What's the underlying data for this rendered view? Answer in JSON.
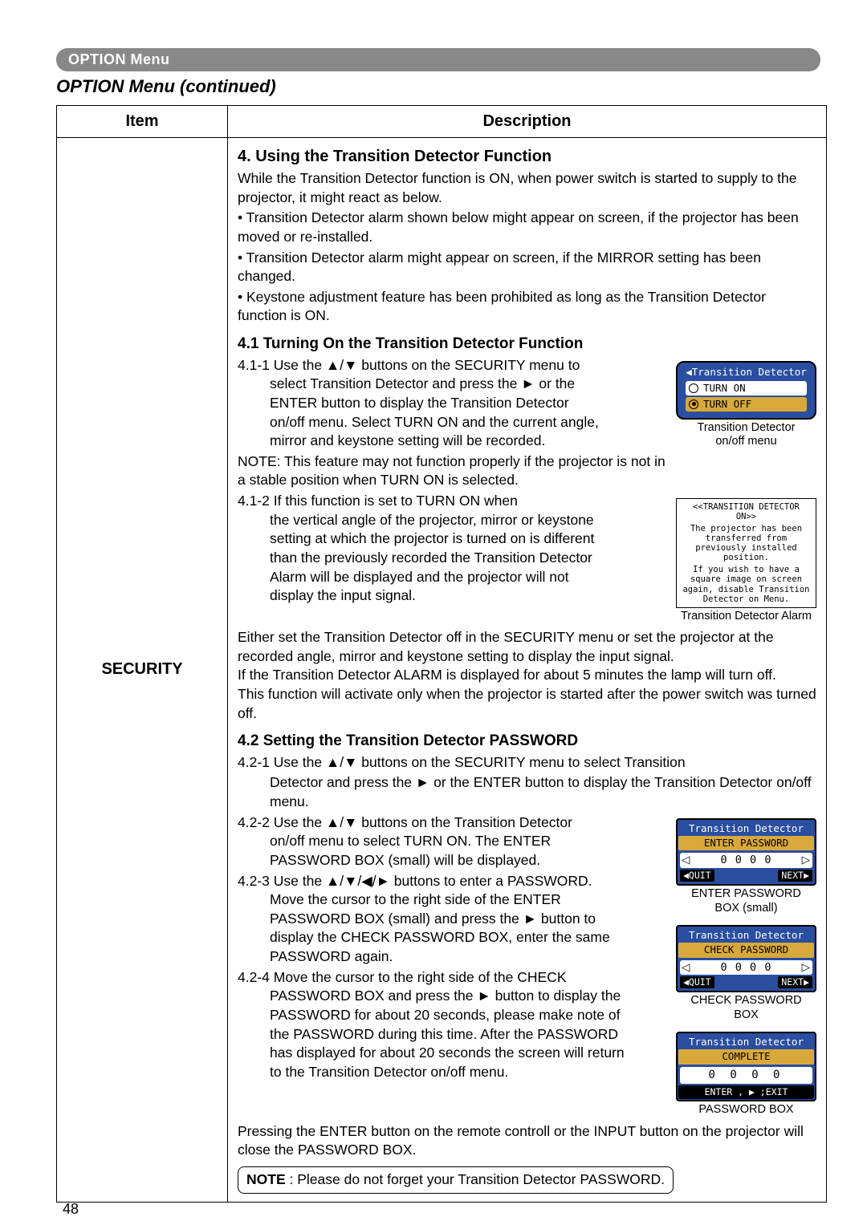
{
  "tab": {
    "label": "OPTION Menu"
  },
  "title": "OPTION Menu (continued)",
  "headers": {
    "item": "Item",
    "description": "Description"
  },
  "item_label": "SECURITY",
  "sec4": {
    "heading": "4. Using the Transition Detector Function",
    "p1": "While the Transition Detector function is ON, when power switch is started to supply to the projector, it might react as below.",
    "b1": "• Transition Detector alarm shown below might appear on screen, if the projector has been moved or re-installed.",
    "b2": "• Transition Detector alarm might appear on screen, if the MIRROR setting has been changed.",
    "b3": "• Keystone adjustment feature has been prohibited as long as the Transition Detector function is ON."
  },
  "sec41": {
    "heading": "4.1 Turning On the Transition Detector Function",
    "s1_lead": "4.1-1 Use the ▲/▼ buttons on the SECURITY menu to",
    "s1_body": "select Transition Detector and press the ► or the ENTER button to display the Transition Detector on/off menu. Select TURN ON and the current angle, mirror and keystone setting will be recorded.",
    "s1_note": "NOTE: This feature may not function properly if the projector is not in a stable position when TURN ON is selected.",
    "s2_lead": "4.1-2 If this function is set to TURN ON when",
    "s2_body": "the vertical angle of the projector, mirror or keystone setting at which the projector is turned on is different than the previously recorded the Transition Detector Alarm will be displayed and the projector will not display the input signal.",
    "after": "Either set the Transition Detector off in the SECURITY menu or set the projector at the recorded angle, mirror and keystone setting to display the input signal.\nIf the Transition Detector ALARM is displayed for about 5 minutes the lamp will turn off.\nThis function will activate only when the projector is started after the power switch was turned off."
  },
  "fig_onoff": {
    "title": "◀Transition Detector",
    "opt_on": "TURN ON",
    "opt_off": "TURN OFF",
    "caption": "Transition Detector\non/off menu"
  },
  "fig_alarm": {
    "l1": "<<TRANSITION DETECTOR ON>>",
    "l2": "The projector has been transferred from previously installed position.",
    "l3": "If you wish to have a square image on screen again, disable Transition Detector on Menu.",
    "caption": "Transition Detector Alarm"
  },
  "sec42": {
    "heading": "4.2 Setting the Transition Detector PASSWORD",
    "s1": "4.2-1 Use the ▲/▼ buttons on the SECURITY menu to select Transition",
    "s1b": "Detector and press the ► or the ENTER button to display the Transition Detector on/off menu.",
    "s2_lead": "4.2-2 Use the ▲/▼ buttons on the Transition Detector",
    "s2_body": "on/off menu to select TURN ON. The ENTER PASSWORD BOX (small) will be displayed.",
    "s3_lead": "4.2-3 Use the ▲/▼/◀/► buttons to enter a PASSWORD.",
    "s3_body": "Move the cursor to the right side of the ENTER PASSWORD BOX (small) and press the ► button to display the CHECK PASSWORD BOX, enter the same PASSWORD again.",
    "s4_lead": "4.2-4 Move the cursor to the right side of the CHECK",
    "s4_body": "PASSWORD BOX and press the ► button to display the PASSWORD for about 20 seconds, please make note of the PASSWORD during this time. After the PASSWORD has displayed for about 20 seconds the screen will return to the Transition Detector on/off menu.",
    "after": "Pressing the ENTER button on the remote controll or the INPUT button on the projector will close the PASSWORD BOX."
  },
  "fig_enter_pw": {
    "brand": "Transition Detector",
    "title": "ENTER PASSWORD",
    "digits": "0 0 0 0",
    "quit": "◀QUIT",
    "next": "NEXT▶",
    "caption": "ENTER PASSWORD\nBOX (small)"
  },
  "fig_check_pw": {
    "brand": "Transition Detector",
    "title": "CHECK PASSWORD",
    "digits": "0 0 0 0",
    "quit": "◀QUIT",
    "next": "NEXT▶",
    "caption": "CHECK PASSWORD\nBOX"
  },
  "fig_complete": {
    "brand": "Transition Detector",
    "title": "COMPLETE",
    "digits": "0 0 0 0",
    "exit": "ENTER , ▶ ;EXIT",
    "caption": "PASSWORD BOX"
  },
  "note": {
    "label": "NOTE",
    "text": " : Please do not forget your Transition Detector PASSWORD."
  },
  "page_number": "48"
}
